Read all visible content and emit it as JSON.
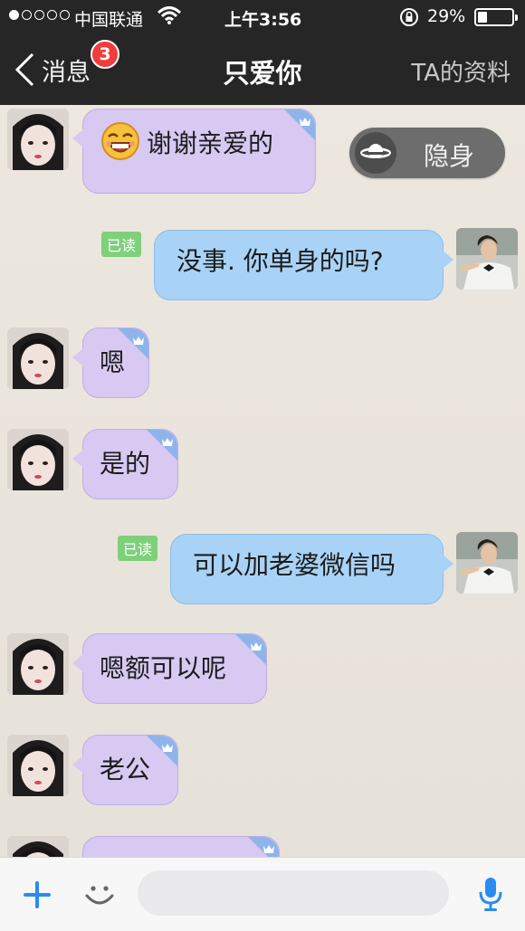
{
  "status_bar": {
    "carrier": "中国联通",
    "time": "上午3:56",
    "battery_percent": "29%",
    "battery_level": 0.29,
    "signal_icon": "signal-dots-icon",
    "wifi_icon": "wifi-icon",
    "lock_icon": "rotation-lock-icon"
  },
  "nav": {
    "back_label": "消息",
    "badge_count": "3",
    "title": "只爱你",
    "profile_label": "TA的资料"
  },
  "stealth_toggle": {
    "label": "隐身",
    "icon": "planet-icon"
  },
  "messages": [
    {
      "side": "left",
      "text": "谢谢亲爱的",
      "emoji": "grin-emoji-icon"
    },
    {
      "side": "right",
      "text": "没事. 你单身的吗?",
      "read": "已读"
    },
    {
      "side": "left",
      "text": "嗯"
    },
    {
      "side": "left",
      "text": "是的"
    },
    {
      "side": "right",
      "text": "可以加老婆微信吗",
      "read": "已读"
    },
    {
      "side": "left",
      "text": "嗯额可以呢"
    },
    {
      "side": "left",
      "text": "老公"
    },
    {
      "side": "left",
      "text": ""
    }
  ],
  "input_bar": {
    "plus_icon": "plus-icon",
    "emoji_icon": "smile-icon",
    "input_value": "",
    "mic_icon": "microphone-icon"
  },
  "colors": {
    "bar_dark": "#262626",
    "left_bubble": "#d8c9f2",
    "right_bubble": "#a9d3f6",
    "read_green": "#7ed07a",
    "badge_red": "#f23b3b",
    "accent_blue": "#2a8cf0"
  }
}
